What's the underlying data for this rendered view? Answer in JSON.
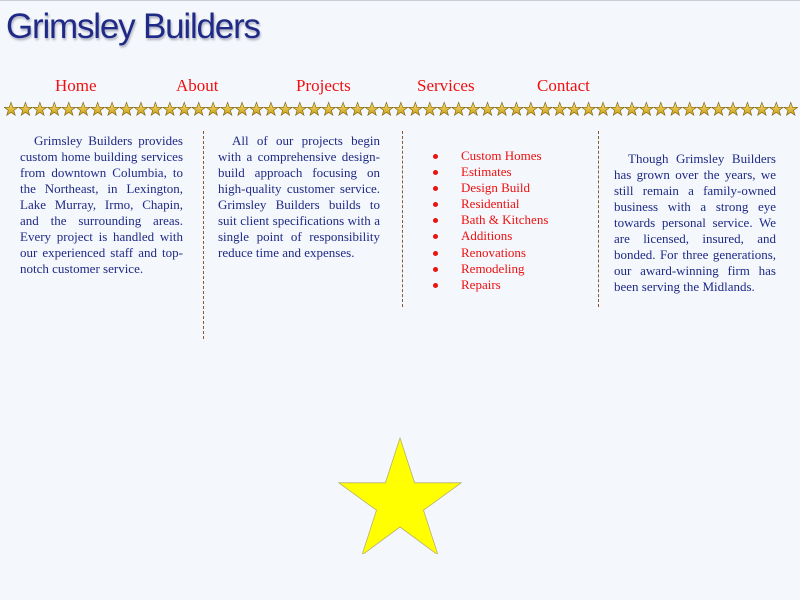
{
  "site": {
    "logo_text": "Grimsley Builders"
  },
  "nav": {
    "items": [
      {
        "label": "Home"
      },
      {
        "label": "About"
      },
      {
        "label": "Projects"
      },
      {
        "label": "Services"
      },
      {
        "label": "Contact"
      }
    ]
  },
  "content": {
    "intro": "Grimsley Builders provides custom home building services from downtown Columbia, to the Northeast, in Lexington, Lake Murray, Irmo, Chapin, and the surrounding areas. Every project is handled with our experienced staff and top-notch customer service.",
    "projects": "All of our projects begin with a comprehensive design-build approach focusing on high-quality customer service. Grimsley Builders builds to suit client specifications with a single point of responsibility reduce time and expenses.",
    "services": [
      "Custom Homes",
      "Estimates",
      "Design Build",
      "Residential",
      "Bath & Kitchens",
      "Additions",
      "Renovations",
      "Remodeling",
      "Repairs"
    ],
    "about": "Though Grimsley Builders has grown over the years, we still remain a family-owned business with a strong eye towards personal service. We are licensed, insured, and bonded. For three generations, our award-winning firm has been serving the Midlands."
  },
  "colors": {
    "background": "#f4f7fb",
    "logo": "#1f2a86",
    "nav_link": "#ee1111",
    "body_text": "#1f2a86",
    "star_fill": "#ffff00",
    "divider": "#8b5a2b"
  },
  "icons": {
    "border": "gold-star-icon",
    "decoration": "yellow-star-icon"
  }
}
